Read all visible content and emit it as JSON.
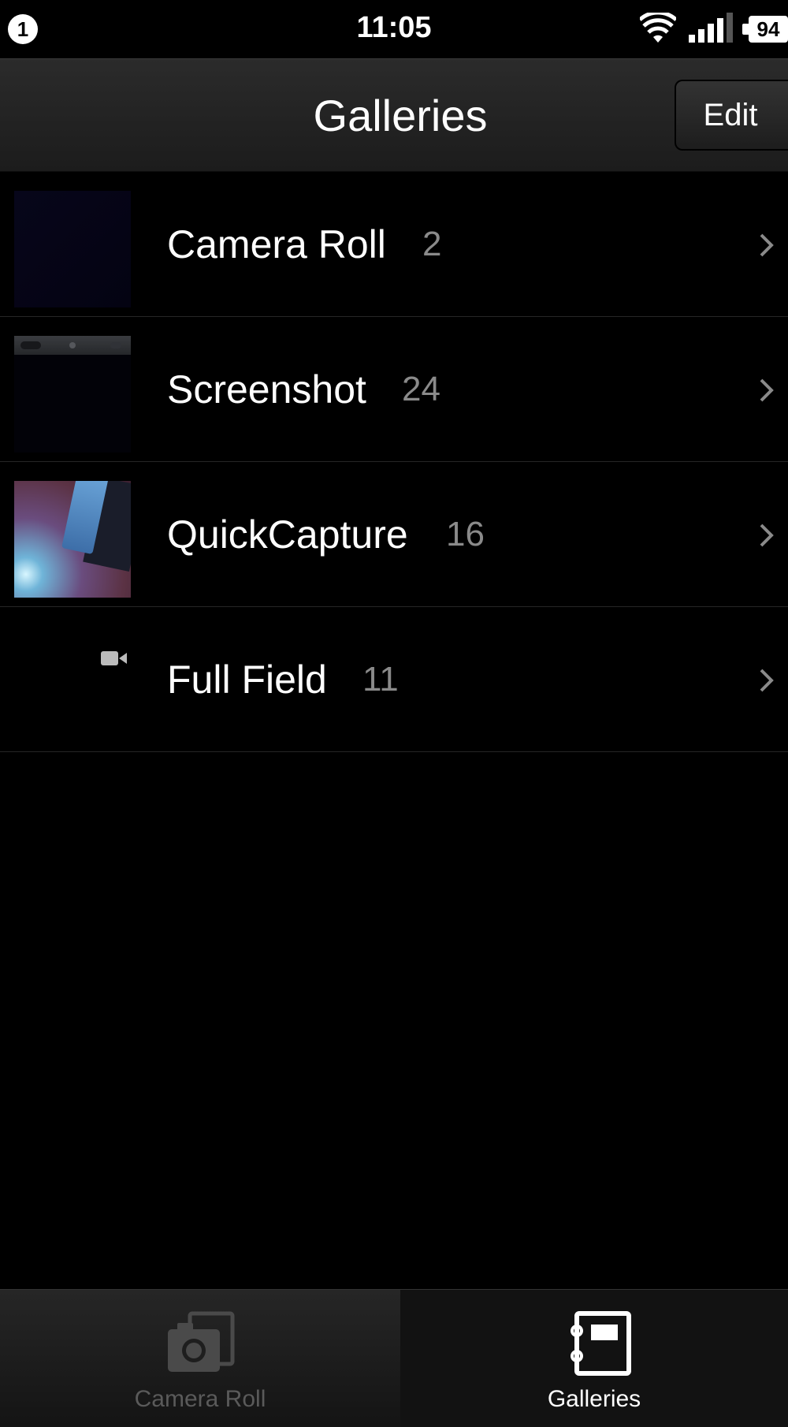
{
  "status_bar": {
    "notification_count": "1",
    "time": "11:05",
    "battery": "94",
    "icons": [
      "wifi-icon",
      "signal-icon",
      "battery-icon"
    ]
  },
  "nav": {
    "title": "Galleries",
    "edit_label": "Edit"
  },
  "galleries": [
    {
      "name": "Camera Roll",
      "count": "2"
    },
    {
      "name": "Screenshot",
      "count": "24"
    },
    {
      "name": "QuickCapture",
      "count": "16"
    },
    {
      "name": "Full Field",
      "count": "11"
    }
  ],
  "tab_bar": {
    "tabs": [
      {
        "label": "Camera Roll",
        "icon": "camera-icon",
        "selected": false
      },
      {
        "label": "Galleries",
        "icon": "album-icon",
        "selected": true
      }
    ]
  },
  "colors": {
    "background": "#000000",
    "count_text": "#8a8a8a",
    "inactive_tab": "#5a5a5a"
  }
}
